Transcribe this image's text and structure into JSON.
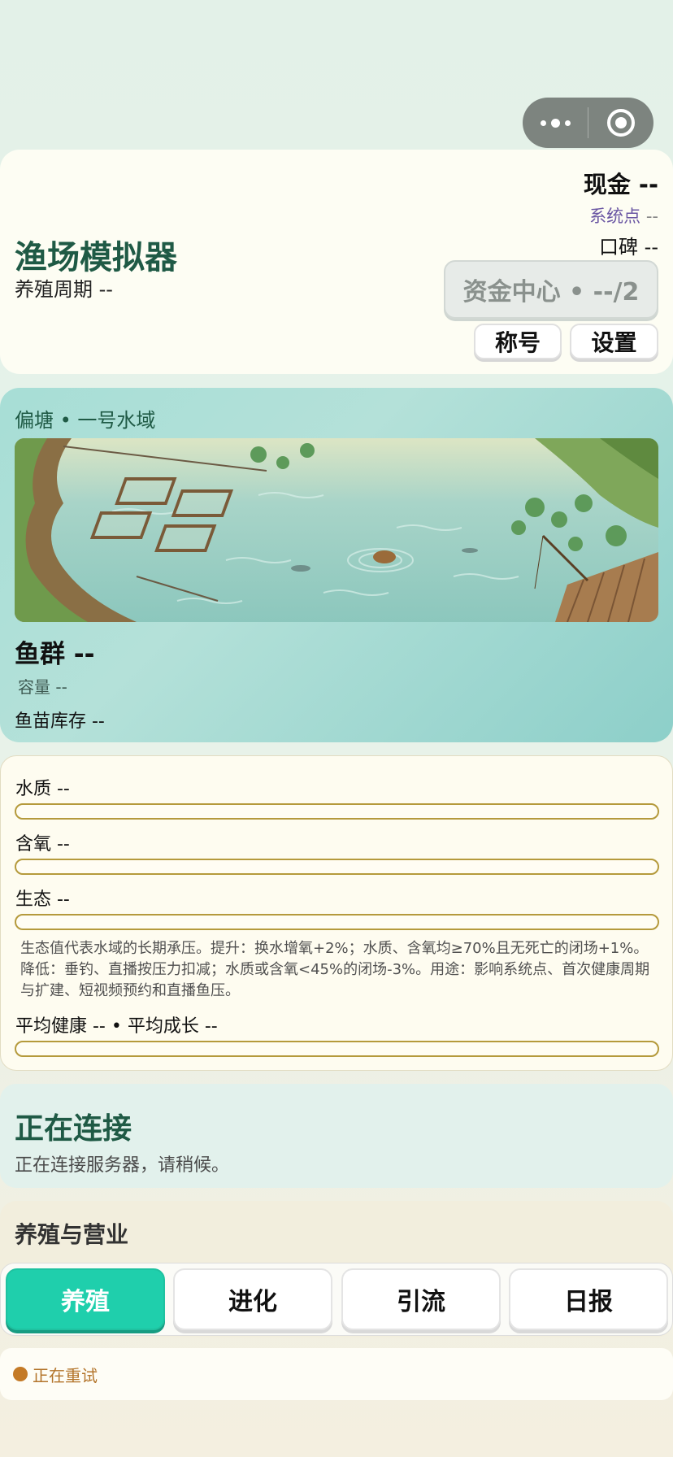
{
  "header": {
    "app_title": "渔场模拟器",
    "cycle": "养殖周期 --",
    "cash": "现金 --",
    "system_points_label": "系统点",
    "system_points_value": "--",
    "reputation": "口碑 --",
    "fund_center": "资金中心 • --/2",
    "title_btn": "称号",
    "settings_btn": "设置"
  },
  "pond": {
    "location": "偏塘 • 一号水域",
    "fish_group": "鱼群 --",
    "capacity": "容量 --",
    "fry_stock": "鱼苗库存 --"
  },
  "stats": {
    "water_quality": "水质 --",
    "oxygen": "含氧 --",
    "ecology": "生态 --",
    "ecology_desc": "生态值代表水域的长期承压。提升：换水增氧+2%；水质、含氧均≥70%且无死亡的闭场+1%。降低：垂钓、直播按压力扣减；水质或含氧<45%的闭场-3%。用途：影响系统点、首次健康周期与扩建、短视频预约和直播鱼压。",
    "avg_health_growth": "平均健康 -- • 平均成长 --"
  },
  "connection": {
    "title": "正在连接",
    "subtitle": "正在连接服务器，请稍候。"
  },
  "ops": {
    "title": "养殖与营业",
    "tabs": [
      "养殖",
      "进化",
      "引流",
      "日报"
    ],
    "active_tab": "养殖"
  },
  "status": {
    "retry_text": "正在重试"
  },
  "colors": {
    "accent": "#1fcfac",
    "title_green": "#1f5a45",
    "bar_border": "#b59a3c",
    "retry": "#c47a26"
  }
}
